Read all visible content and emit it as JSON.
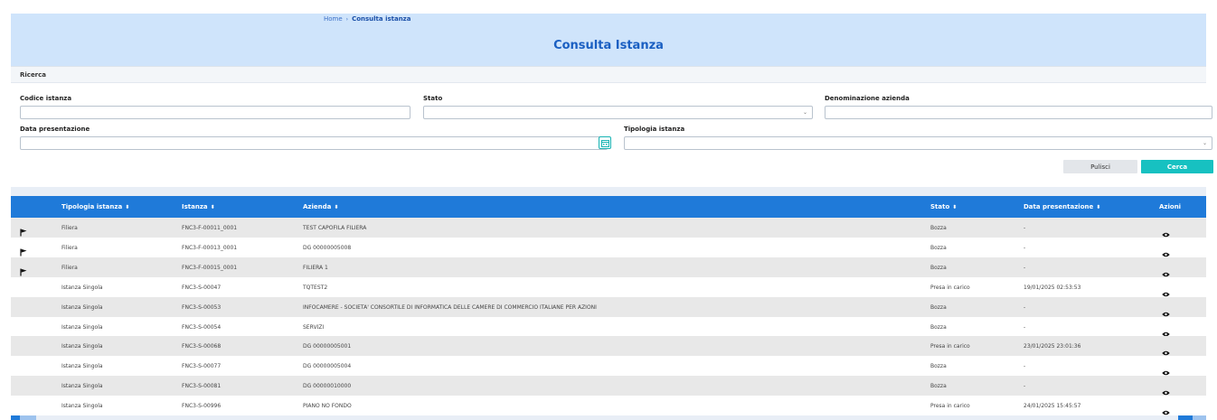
{
  "breadcrumb": {
    "home": "Home",
    "separator": "›",
    "current": "Consulta istanza"
  },
  "page": {
    "title": "Consulta Istanza"
  },
  "search": {
    "section_title": "Ricerca",
    "fields": {
      "codice_istanza": {
        "label": "Codice istanza",
        "value": ""
      },
      "stato": {
        "label": "Stato",
        "value": ""
      },
      "denominazione_azienda": {
        "label": "Denominazione azienda",
        "value": ""
      },
      "data_presentazione": {
        "label": "Data presentazione",
        "value": ""
      },
      "tipologia_istanza": {
        "label": "Tipologia istanza",
        "value": ""
      }
    },
    "buttons": {
      "clear": "Pulisci",
      "search": "Cerca"
    }
  },
  "table": {
    "sort_icon": "⬍",
    "columns": {
      "tipologia": "Tipologia istanza",
      "istanza": "Istanza",
      "azienda": "Azienda",
      "stato": "Stato",
      "data": "Data presentazione",
      "azioni": "Azioni"
    },
    "rows": [
      {
        "flag": true,
        "tipologia": "Filiera",
        "istanza": "FNC3-F-00011_0001",
        "azienda": "TEST CAPOFILA FILIERA",
        "stato": "Bozza",
        "data": "-"
      },
      {
        "flag": true,
        "tipologia": "Filiera",
        "istanza": "FNC3-F-00013_0001",
        "azienda": "DG 00000005008",
        "stato": "Bozza",
        "data": "-"
      },
      {
        "flag": true,
        "tipologia": "Filiera",
        "istanza": "FNC3-F-00015_0001",
        "azienda": "FILIERA 1",
        "stato": "Bozza",
        "data": "-"
      },
      {
        "flag": false,
        "tipologia": "Istanza Singola",
        "istanza": "FNC3-S-00047",
        "azienda": "TQTEST2",
        "stato": "Presa in carico",
        "data": "19/01/2025 02:53:53"
      },
      {
        "flag": false,
        "tipologia": "Istanza Singola",
        "istanza": "FNC3-S-00053",
        "azienda": "INFOCAMERE - SOCIETA' CONSORTILE DI INFORMATICA DELLE CAMERE DI COMMERCIO ITALIANE PER AZIONI",
        "stato": "Bozza",
        "data": "-"
      },
      {
        "flag": false,
        "tipologia": "Istanza Singola",
        "istanza": "FNC3-S-00054",
        "azienda": "SERVIZI",
        "stato": "Bozza",
        "data": "-"
      },
      {
        "flag": false,
        "tipologia": "Istanza Singola",
        "istanza": "FNC3-S-00068",
        "azienda": "DG 00000005001",
        "stato": "Presa in carico",
        "data": "23/01/2025 23:01:36"
      },
      {
        "flag": false,
        "tipologia": "Istanza Singola",
        "istanza": "FNC3-S-00077",
        "azienda": "DG 00000005004",
        "stato": "Bozza",
        "data": "-"
      },
      {
        "flag": false,
        "tipologia": "Istanza Singola",
        "istanza": "FNC3-S-00081",
        "azienda": "DG 00000010000",
        "stato": "Bozza",
        "data": "-"
      },
      {
        "flag": false,
        "tipologia": "Istanza Singola",
        "istanza": "FNC3-S-00996",
        "azienda": "PIANO NO FONDO",
        "stato": "Presa in carico",
        "data": "24/01/2025 15:45:57"
      }
    ]
  },
  "icons": {
    "flag": "flag-icon",
    "view": "eye-icon",
    "calendar": "calendar-icon",
    "select": "chevron-down-icon"
  },
  "colors": {
    "header_bg": "#cfe4fb",
    "title": "#1a5fc2",
    "table_header": "#1f7ad9",
    "search_button": "#17c1c1"
  }
}
